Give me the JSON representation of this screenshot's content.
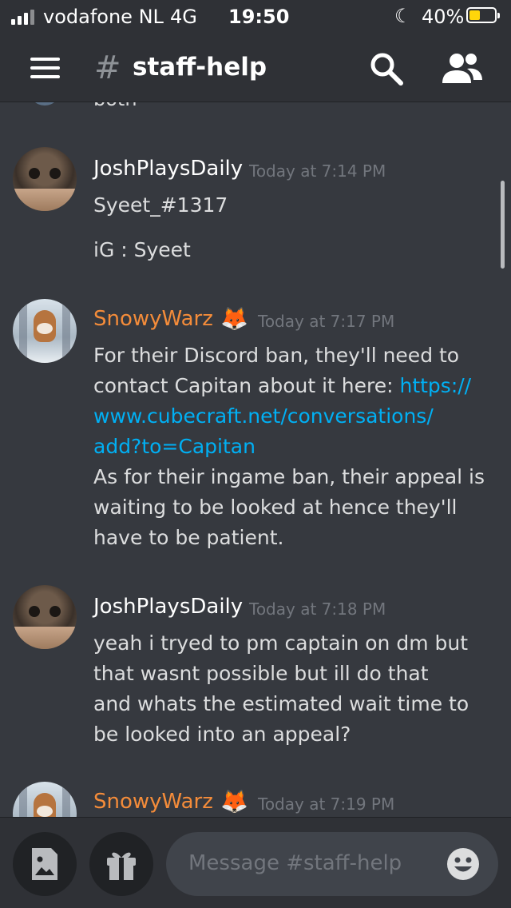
{
  "status_bar": {
    "carrier": "vodafone NL",
    "network": "4G",
    "time": "19:50",
    "battery_percent": "40%",
    "battery_level": 0.4,
    "icons": [
      "signal-icon",
      "moon-icon",
      "battery-icon"
    ]
  },
  "header": {
    "hash_symbol": "#",
    "channel_name": "staff-help",
    "icons": [
      "menu-icon",
      "search-icon",
      "members-icon"
    ]
  },
  "previous_fragment": "both",
  "messages": [
    {
      "author": "JoshPlaysDaily",
      "timestamp": "Today at 7:14 PM",
      "lines": [
        "Syeet_#1317",
        "iG :   Syeet"
      ]
    },
    {
      "author": "SnowyWarz",
      "author_emoji": "🦊",
      "timestamp": "Today at 7:17 PM",
      "text_before_link": "For their Discord ban, they'll need to contact Capitan about it here: ",
      "lines_before_link": [
        "For their Discord ban, they'll need to",
        "contact Capitan about it here: "
      ],
      "link_lines": [
        "https://",
        "www.cubecraft.net/conversations/",
        "add?to=Capitan"
      ],
      "lines_after_link": [
        "As for their ingame ban, their appeal is",
        "waiting to be looked at hence they'll",
        "have to be patient."
      ]
    },
    {
      "author": "JoshPlaysDaily",
      "timestamp": "Today at 7:18 PM",
      "lines": [
        "yeah i tryed to pm   captain on  dm  but",
        "that wasnt possible    but ill do that",
        "and whats the estimated   wait time to",
        "be looked into an appeal?"
      ]
    },
    {
      "author": "SnowyWarz",
      "author_emoji": "🦊",
      "timestamp": "Today at 7:19 PM"
    }
  ],
  "composer": {
    "placeholder": "Message #staff-help",
    "icons": [
      "image-upload-icon",
      "gift-icon",
      "emoji-icon"
    ]
  },
  "colors": {
    "background": "#36393f",
    "header": "#2f3136",
    "link": "#00b0f4",
    "snowy_name": "#f48c3a",
    "timestamp": "#72767d"
  }
}
